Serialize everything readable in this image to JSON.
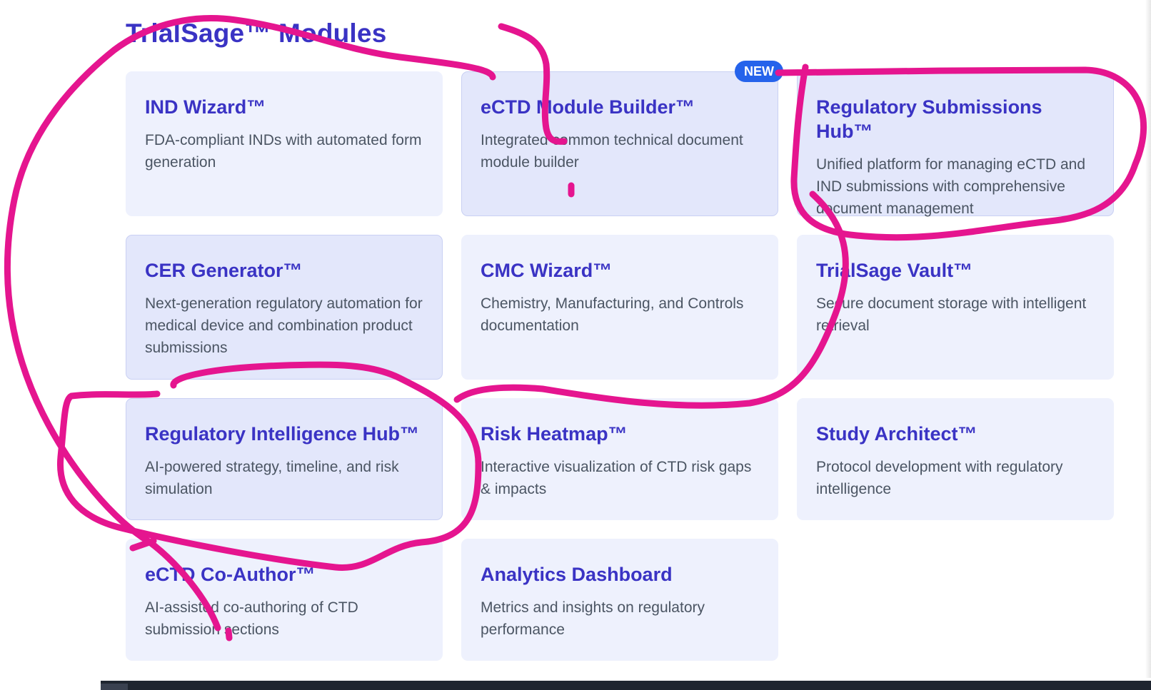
{
  "page": {
    "title": "TrialSage™ Modules"
  },
  "accent_color": "#3a33c4",
  "annotation_color": "#e5158f",
  "modules": [
    {
      "title": "IND Wizard™",
      "description": "FDA-compliant INDs with automated form generation"
    },
    {
      "title": "eCTD Module Builder™",
      "description": "Integrated common technical document module builder",
      "badge": "NEW"
    },
    {
      "title": "Regulatory Submissions Hub™",
      "description": "Unified platform for managing eCTD and IND submissions with comprehensive document management"
    },
    {
      "title": "CER Generator™",
      "description": "Next-generation regulatory automation for medical device and combination product submissions"
    },
    {
      "title": "CMC Wizard™",
      "description": "Chemistry, Manufacturing, and Controls documentation"
    },
    {
      "title": "TrialSage Vault™",
      "description": "Secure document storage with intelligent retrieval"
    },
    {
      "title": "Regulatory Intelligence Hub™",
      "description": "AI-powered strategy, timeline, and risk simulation"
    },
    {
      "title": "Risk Heatmap™",
      "description": "Interactive visualization of CTD risk gaps & impacts"
    },
    {
      "title": "Study Architect™",
      "description": "Protocol development with regulatory intelligence"
    },
    {
      "title": "eCTD Co-Author™",
      "description": "AI-assisted co-authoring of CTD submission sections"
    },
    {
      "title": "Analytics Dashboard",
      "description": "Metrics and insights on regulatory performance"
    }
  ]
}
